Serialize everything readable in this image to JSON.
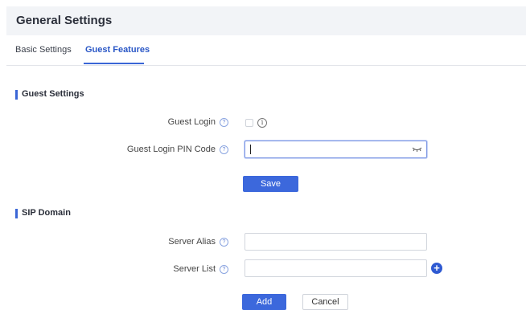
{
  "header": {
    "title": "General Settings"
  },
  "tabs": [
    {
      "label": "Basic Settings",
      "active": false
    },
    {
      "label": "Guest Features",
      "active": true
    }
  ],
  "guest_settings": {
    "section_title": "Guest Settings",
    "guest_login_label": "Guest Login",
    "guest_login_checked": false,
    "info_glyph": "i",
    "pin_code_label": "Guest Login PIN Code",
    "pin_code_value": "",
    "save_label": "Save"
  },
  "sip_domain": {
    "section_title": "SIP Domain",
    "server_alias_label": "Server Alias",
    "server_alias_value": "",
    "server_list_label": "Server List",
    "server_list_value": "",
    "add_label": "Add",
    "cancel_label": "Cancel"
  },
  "icons": {
    "help": "question-circle-icon",
    "info": "info-circle-icon",
    "eye": "eye-closed-icon",
    "plus": "plus-circle-icon"
  },
  "colors": {
    "accent": "#3c68dc",
    "header_bg": "#f2f4f7"
  }
}
